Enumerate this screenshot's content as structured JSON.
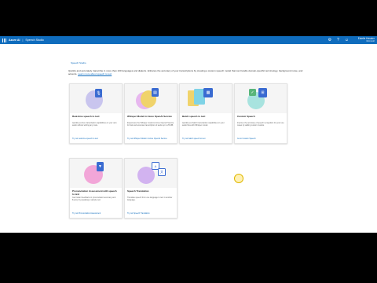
{
  "app": {
    "brand": "Azure AI",
    "product": "Speech Studio"
  },
  "user": {
    "name": "Estelle Hessler",
    "org": "Microsoft"
  },
  "breadcrumb": "Speech Studio",
  "intro": {
    "text": "Quickly and accurately transcribe in more than 100 languages and dialects. Enhance the accuracy of your transcriptions by creating a custom speech model that can handle domain-specific terminology, background noise, and accents.",
    "link": "Learn more about speech to text"
  },
  "cards": [
    {
      "title": "Real-time speech to text",
      "desc": "Quickly test live transcription capabilities on your own audio without writing any code.",
      "link": "Try out real-time speech to text"
    },
    {
      "title": "Whisper Model in Azure OpenAI Service",
      "desc": "Experience the Whisper model in Azure OpenAI Service for fast and accurate transcription of audio up to 25 MB.",
      "link": "Try out Whisper Model in Azure OpenAI Service"
    },
    {
      "title": "Batch speech to text",
      "desc": "Quickly test batch transcription capabilities on your audio files with Whisper model.",
      "link": "Try out batch speech to text"
    },
    {
      "title": "Custom Speech",
      "desc": "Improve the accuracy of speech recognition for your use cases by adding custom models.",
      "link": "Go to Custom Speech"
    },
    {
      "title": "Pronunciation Assessment with speech to text",
      "desc": "Get instant feedback on pronunciation accuracy and fluency by speaking a sample text.",
      "link": "Try out Pronunciation Assessment"
    },
    {
      "title": "Speech Translation",
      "desc": "Translate speech from one language to text in another language.",
      "link": "Try out Speech Translation"
    }
  ],
  "colors": {
    "accent": "#0f6cbd"
  }
}
